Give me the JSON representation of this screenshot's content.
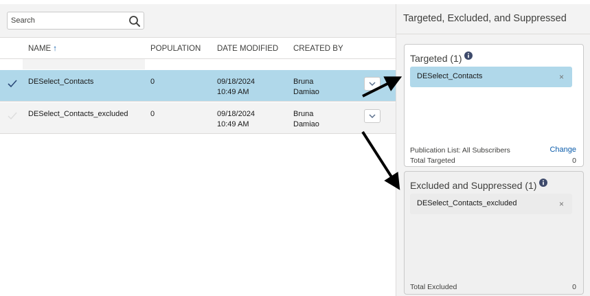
{
  "search": {
    "placeholder": "Search",
    "value": ""
  },
  "table": {
    "columns": [
      {
        "label": "NAME",
        "sort": "ascending"
      },
      {
        "label": "POPULATION"
      },
      {
        "label": "DATE MODIFIED"
      },
      {
        "label": "CREATED BY"
      }
    ],
    "sort_glyph": "↑",
    "rows": [
      {
        "name": "DESelect_Contacts",
        "population": "0",
        "date": "09/18/2024",
        "time": "10:49 AM",
        "creator_first": "Bruna",
        "creator_last": "Damiao",
        "selected": true
      },
      {
        "name": "DESelect_Contacts_excluded",
        "population": "0",
        "date": "09/18/2024",
        "time": "10:49 AM",
        "creator_first": "Bruna",
        "creator_last": "Damiao",
        "selected": false
      }
    ]
  },
  "panel": {
    "title": "Targeted, Excluded, and Suppressed",
    "targeted": {
      "title": "Targeted (1)",
      "item": "DESelect_Contacts",
      "publication_label": "Publication List:  All Subscribers",
      "change_label": "Change",
      "total_label": "Total Targeted",
      "total_value": "0"
    },
    "excluded": {
      "title": "Excluded and Suppressed (1)",
      "item": "DESelect_Contacts_excluded",
      "total_label": "Total Excluded",
      "total_value": "0"
    },
    "remove_glyph": "×"
  },
  "colors": {
    "selected_row": "#b0d8ea",
    "accent_blue": "#0b5cab",
    "info_icon": "#3e4a6b",
    "arrow": "#000000"
  },
  "icons": [
    "search-icon",
    "checkmark-icon",
    "chevron-down-icon",
    "info-icon",
    "close-icon",
    "arrow-annotation"
  ]
}
